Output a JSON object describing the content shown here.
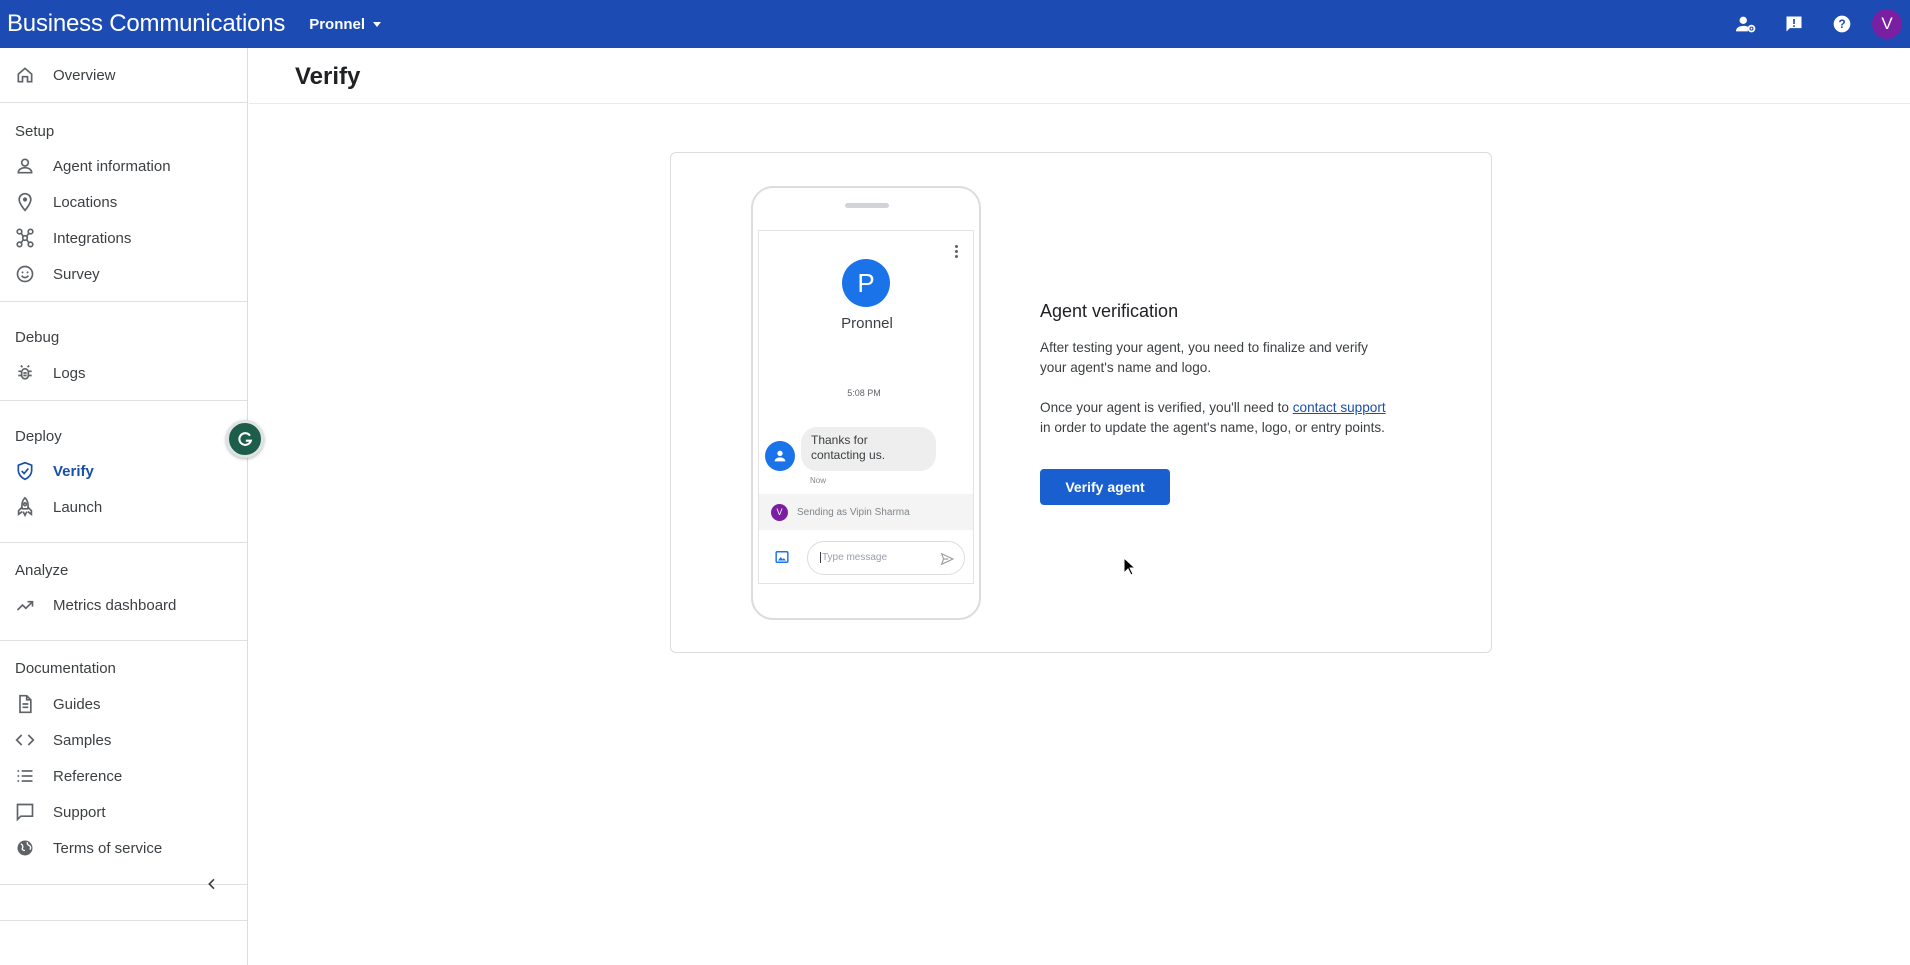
{
  "topbar": {
    "brand": "Business Communications",
    "project": "Pronnel",
    "avatar_letter": "V",
    "icons": [
      "manage-accounts-icon",
      "feedback-icon",
      "help-icon"
    ]
  },
  "sidebar": {
    "overview": "Overview",
    "sections": {
      "setup": "Setup",
      "debug": "Debug",
      "deploy": "Deploy",
      "analyze": "Analyze",
      "documentation": "Documentation"
    },
    "items": {
      "agent_information": "Agent information",
      "locations": "Locations",
      "integrations": "Integrations",
      "survey": "Survey",
      "logs": "Logs",
      "verify": "Verify",
      "launch": "Launch",
      "metrics_dashboard": "Metrics dashboard",
      "guides": "Guides",
      "samples": "Samples",
      "reference": "Reference",
      "support": "Support",
      "terms_of_service": "Terms of service"
    },
    "active_item": "Verify"
  },
  "page": {
    "title": "Verify"
  },
  "phone": {
    "logo_letter": "P",
    "agent_name": "Pronnel",
    "time": "5:08 PM",
    "message_line1": "Thanks for",
    "message_line2": "contacting us.",
    "message_status": "Now",
    "sender_initial": "V",
    "sending_as": "Sending as Vipin Sharma",
    "composer_placeholder": "Type message"
  },
  "verification": {
    "heading": "Agent verification",
    "para1_line1": "After testing your agent, you need to finalize and verify",
    "para1_line2": "your agent's name and logo.",
    "para2_before": "Once your agent is verified, you'll need to ",
    "para2_link": "contact support",
    "para2_after": "in order to update the agent's name, logo, or entry points.",
    "button": "Verify agent"
  },
  "colors": {
    "topbar": "#1c4bb3",
    "accent": "#1a5fd0",
    "active_nav": "#1a4fa8",
    "avatar": "#7b1fa2"
  }
}
